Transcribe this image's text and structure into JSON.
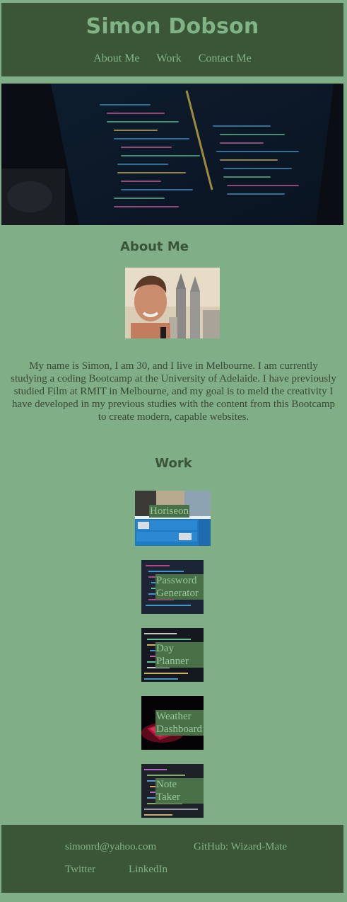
{
  "header": {
    "title": "Simon Dobson",
    "nav": [
      "About Me",
      "Work",
      "Contact Me"
    ]
  },
  "about": {
    "heading": "About Me",
    "bio": "My name is Simon, I am 30, and I live in Melbourne. I am currently studying a coding Bootcamp at the University of Adelaide. I have previously studied Film at RMIT in Melbourne, and my goal is to meld the creativity I have developed in my previous studies with the content from this Bootcamp to create modern, capable websites."
  },
  "work": {
    "heading": "Work",
    "projects": [
      {
        "label": "Horiseon"
      },
      {
        "label": "Password Generator"
      },
      {
        "label": "Day Planner"
      },
      {
        "label": "Weather Dashboard"
      },
      {
        "label": "Note Taker"
      }
    ]
  },
  "footer": {
    "email": "simonrd@yahoo.com",
    "github": "GitHub: Wizard-Mate",
    "twitter": "Twitter",
    "linkedin": "LinkedIn"
  },
  "colors": {
    "page_bg": "#7fae87",
    "header_bg": "#3a5636",
    "accent_text": "#80b485",
    "label_bg": "#4a7048"
  }
}
